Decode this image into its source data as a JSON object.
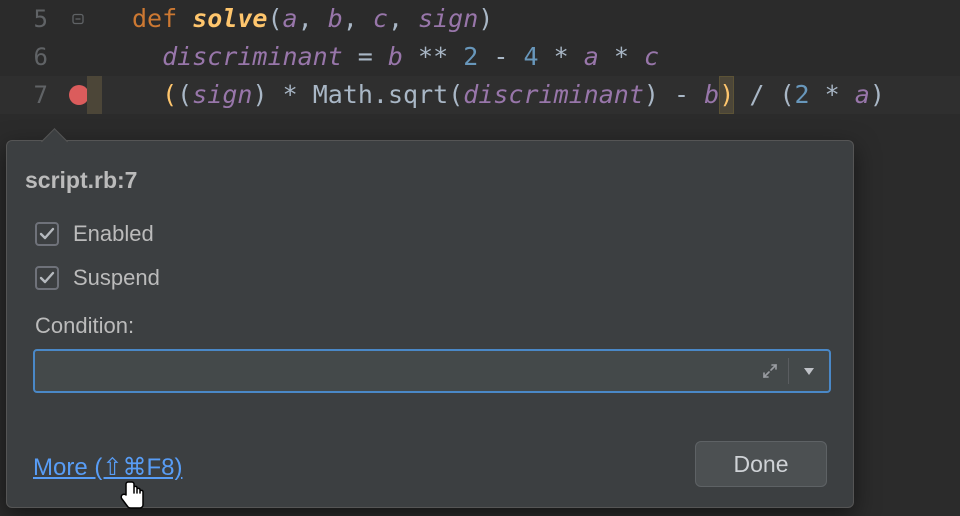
{
  "editor": {
    "lines": [
      {
        "number": "5"
      },
      {
        "number": "6"
      },
      {
        "number": "7"
      }
    ],
    "tokens": {
      "def": "def",
      "solve": "solve",
      "a": "a",
      "b": "b",
      "c": "c",
      "sign": "sign",
      "discriminant": "discriminant",
      "eq": "=",
      "pow": "**",
      "two": "2",
      "four": "4",
      "minus": "-",
      "star": "*",
      "Math": "Math",
      "sqrt": "sqrt",
      "slash": "/",
      "lp": "(",
      "rp": ")",
      "comma": ", ",
      "dot": "."
    }
  },
  "popup": {
    "title": "script.rb:7",
    "enabled_label": "Enabled",
    "suspend_label": "Suspend",
    "condition_label": "Condition:",
    "condition_value": "",
    "more_label": "More (⇧⌘F8)",
    "done_label": "Done"
  },
  "icons": {
    "breakpoint": "breakpoint",
    "fold": "fold",
    "check": "check",
    "expand": "expand",
    "dropdown": "dropdown",
    "pointer": "pointer"
  }
}
